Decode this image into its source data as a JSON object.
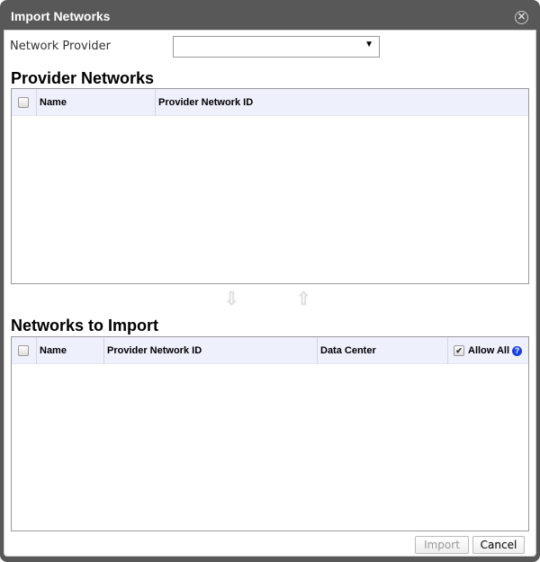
{
  "dialog": {
    "title": "Import Networks"
  },
  "provider": {
    "label": "Network Provider",
    "value": ""
  },
  "provider_networks": {
    "title": "Provider Networks",
    "columns": [
      "Name",
      "Provider Network ID"
    ]
  },
  "networks_to_import": {
    "title": "Networks to Import",
    "columns": [
      "Name",
      "Provider Network ID",
      "Data Center"
    ],
    "allow_all_label": "Allow All",
    "allow_all_checked": true
  },
  "buttons": {
    "import": "Import",
    "cancel": "Cancel"
  }
}
